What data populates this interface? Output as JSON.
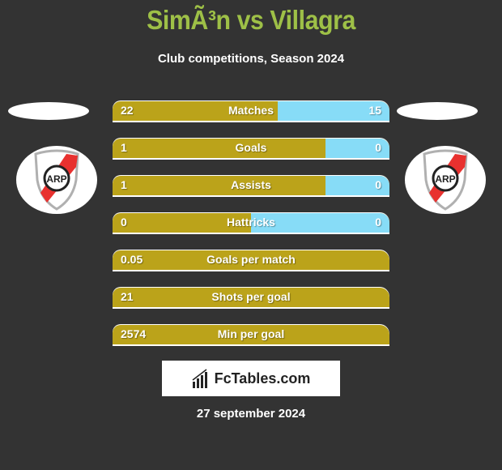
{
  "header": {
    "title": "SimÃ³n vs Villagra",
    "subtitle": "Club competitions, Season 2024"
  },
  "teams": {
    "left": {
      "logo": "river-plate-crest-icon"
    },
    "right": {
      "logo": "river-plate-crest-icon"
    }
  },
  "colors": {
    "left_bar": "#bba31a",
    "right_bar": "#87dcf7",
    "title": "#9ec047",
    "background": "#333333"
  },
  "stats": [
    {
      "label": "Matches",
      "left": "22",
      "right": "15",
      "left_share": 0.595
    },
    {
      "label": "Goals",
      "left": "1",
      "right": "0",
      "left_share": 0.77
    },
    {
      "label": "Assists",
      "left": "1",
      "right": "0",
      "left_share": 0.77
    },
    {
      "label": "Hattricks",
      "left": "0",
      "right": "0",
      "left_share": 0.5
    },
    {
      "label": "Goals per match",
      "left": "0.05",
      "right": "",
      "left_share": 1.0
    },
    {
      "label": "Shots per goal",
      "left": "21",
      "right": "",
      "left_share": 1.0
    },
    {
      "label": "Min per goal",
      "left": "2574",
      "right": "",
      "left_share": 1.0
    }
  ],
  "brand": {
    "name": "FcTables.com",
    "icon": "bar-chart-icon"
  },
  "footer": {
    "date": "27 september 2024"
  }
}
